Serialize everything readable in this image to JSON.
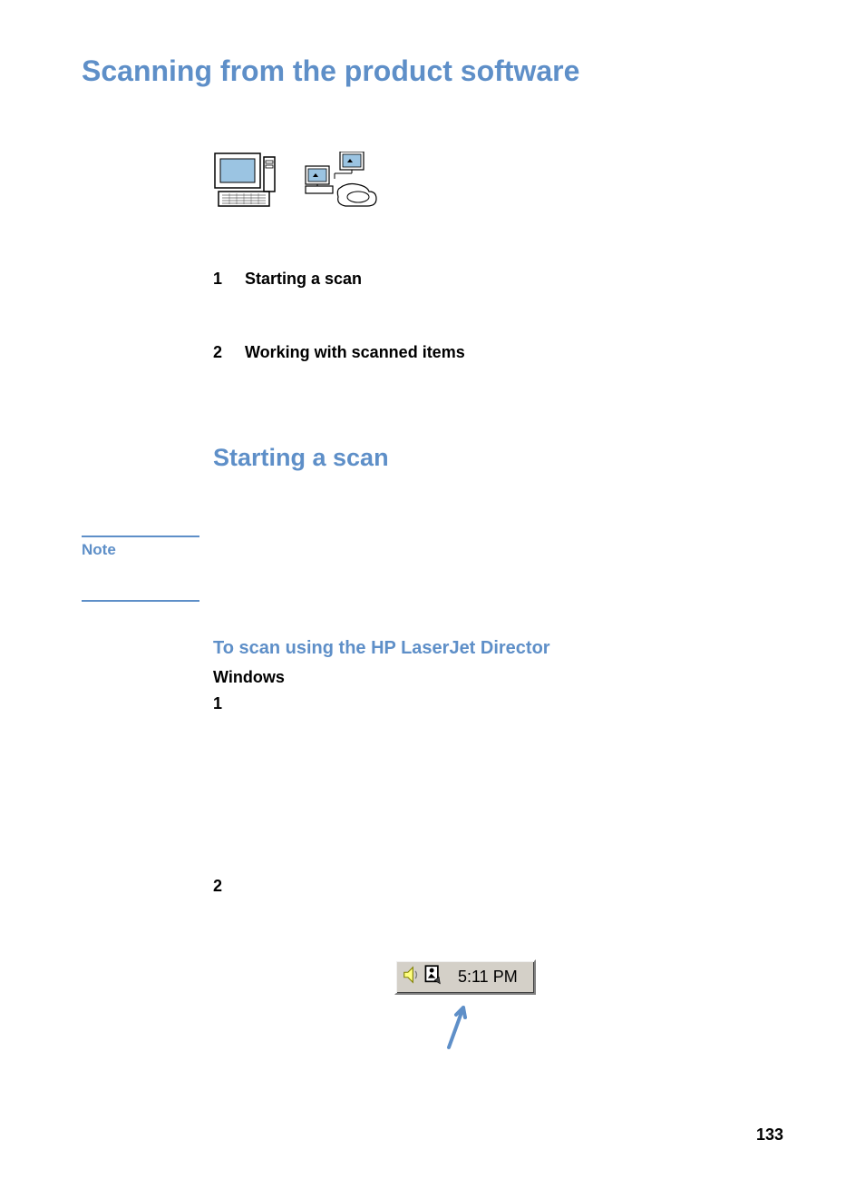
{
  "heading1": "Scanning from the product software",
  "toc": [
    {
      "num": "1",
      "label": "Starting a scan"
    },
    {
      "num": "2",
      "label": "Working with scanned items"
    }
  ],
  "heading2": "Starting a scan",
  "noteLabel": "Note",
  "heading3": "To scan using the HP LaserJet Director",
  "heading4": "Windows",
  "steps": [
    "1",
    "2"
  ],
  "trayTime": "5:11 PM",
  "pageNumber": "133"
}
